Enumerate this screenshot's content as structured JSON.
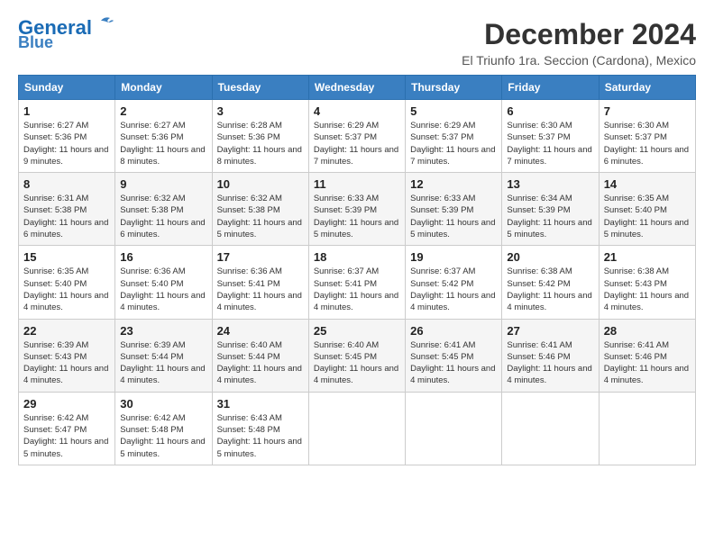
{
  "header": {
    "title": "December 2024",
    "subtitle": "El Triunfo 1ra. Seccion (Cardona), Mexico",
    "logo_line1": "General",
    "logo_line2": "Blue"
  },
  "columns": [
    "Sunday",
    "Monday",
    "Tuesday",
    "Wednesday",
    "Thursday",
    "Friday",
    "Saturday"
  ],
  "weeks": [
    [
      {
        "day": "1",
        "info": "Sunrise: 6:27 AM\nSunset: 5:36 PM\nDaylight: 11 hours and 9 minutes."
      },
      {
        "day": "2",
        "info": "Sunrise: 6:27 AM\nSunset: 5:36 PM\nDaylight: 11 hours and 8 minutes."
      },
      {
        "day": "3",
        "info": "Sunrise: 6:28 AM\nSunset: 5:36 PM\nDaylight: 11 hours and 8 minutes."
      },
      {
        "day": "4",
        "info": "Sunrise: 6:29 AM\nSunset: 5:37 PM\nDaylight: 11 hours and 7 minutes."
      },
      {
        "day": "5",
        "info": "Sunrise: 6:29 AM\nSunset: 5:37 PM\nDaylight: 11 hours and 7 minutes."
      },
      {
        "day": "6",
        "info": "Sunrise: 6:30 AM\nSunset: 5:37 PM\nDaylight: 11 hours and 7 minutes."
      },
      {
        "day": "7",
        "info": "Sunrise: 6:30 AM\nSunset: 5:37 PM\nDaylight: 11 hours and 6 minutes."
      }
    ],
    [
      {
        "day": "8",
        "info": "Sunrise: 6:31 AM\nSunset: 5:38 PM\nDaylight: 11 hours and 6 minutes."
      },
      {
        "day": "9",
        "info": "Sunrise: 6:32 AM\nSunset: 5:38 PM\nDaylight: 11 hours and 6 minutes."
      },
      {
        "day": "10",
        "info": "Sunrise: 6:32 AM\nSunset: 5:38 PM\nDaylight: 11 hours and 5 minutes."
      },
      {
        "day": "11",
        "info": "Sunrise: 6:33 AM\nSunset: 5:39 PM\nDaylight: 11 hours and 5 minutes."
      },
      {
        "day": "12",
        "info": "Sunrise: 6:33 AM\nSunset: 5:39 PM\nDaylight: 11 hours and 5 minutes."
      },
      {
        "day": "13",
        "info": "Sunrise: 6:34 AM\nSunset: 5:39 PM\nDaylight: 11 hours and 5 minutes."
      },
      {
        "day": "14",
        "info": "Sunrise: 6:35 AM\nSunset: 5:40 PM\nDaylight: 11 hours and 5 minutes."
      }
    ],
    [
      {
        "day": "15",
        "info": "Sunrise: 6:35 AM\nSunset: 5:40 PM\nDaylight: 11 hours and 4 minutes."
      },
      {
        "day": "16",
        "info": "Sunrise: 6:36 AM\nSunset: 5:40 PM\nDaylight: 11 hours and 4 minutes."
      },
      {
        "day": "17",
        "info": "Sunrise: 6:36 AM\nSunset: 5:41 PM\nDaylight: 11 hours and 4 minutes."
      },
      {
        "day": "18",
        "info": "Sunrise: 6:37 AM\nSunset: 5:41 PM\nDaylight: 11 hours and 4 minutes."
      },
      {
        "day": "19",
        "info": "Sunrise: 6:37 AM\nSunset: 5:42 PM\nDaylight: 11 hours and 4 minutes."
      },
      {
        "day": "20",
        "info": "Sunrise: 6:38 AM\nSunset: 5:42 PM\nDaylight: 11 hours and 4 minutes."
      },
      {
        "day": "21",
        "info": "Sunrise: 6:38 AM\nSunset: 5:43 PM\nDaylight: 11 hours and 4 minutes."
      }
    ],
    [
      {
        "day": "22",
        "info": "Sunrise: 6:39 AM\nSunset: 5:43 PM\nDaylight: 11 hours and 4 minutes."
      },
      {
        "day": "23",
        "info": "Sunrise: 6:39 AM\nSunset: 5:44 PM\nDaylight: 11 hours and 4 minutes."
      },
      {
        "day": "24",
        "info": "Sunrise: 6:40 AM\nSunset: 5:44 PM\nDaylight: 11 hours and 4 minutes."
      },
      {
        "day": "25",
        "info": "Sunrise: 6:40 AM\nSunset: 5:45 PM\nDaylight: 11 hours and 4 minutes."
      },
      {
        "day": "26",
        "info": "Sunrise: 6:41 AM\nSunset: 5:45 PM\nDaylight: 11 hours and 4 minutes."
      },
      {
        "day": "27",
        "info": "Sunrise: 6:41 AM\nSunset: 5:46 PM\nDaylight: 11 hours and 4 minutes."
      },
      {
        "day": "28",
        "info": "Sunrise: 6:41 AM\nSunset: 5:46 PM\nDaylight: 11 hours and 4 minutes."
      }
    ],
    [
      {
        "day": "29",
        "info": "Sunrise: 6:42 AM\nSunset: 5:47 PM\nDaylight: 11 hours and 5 minutes."
      },
      {
        "day": "30",
        "info": "Sunrise: 6:42 AM\nSunset: 5:48 PM\nDaylight: 11 hours and 5 minutes."
      },
      {
        "day": "31",
        "info": "Sunrise: 6:43 AM\nSunset: 5:48 PM\nDaylight: 11 hours and 5 minutes."
      },
      null,
      null,
      null,
      null
    ]
  ]
}
